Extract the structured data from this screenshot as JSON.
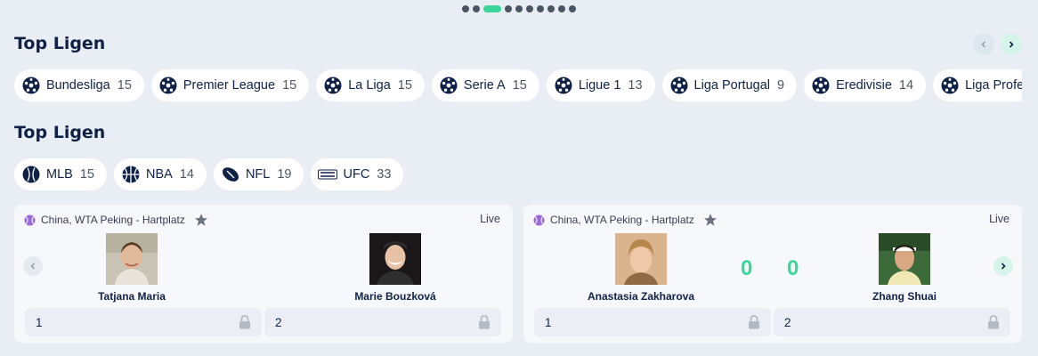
{
  "pager": {
    "count": 10,
    "active_index": 2
  },
  "top_leagues": {
    "title": "Top Ligen",
    "items": [
      {
        "label": "Bundesliga",
        "count": "15",
        "icon": "soccer-ball-icon"
      },
      {
        "label": "Premier League",
        "count": "15",
        "icon": "soccer-ball-icon"
      },
      {
        "label": "La Liga",
        "count": "15",
        "icon": "soccer-ball-icon"
      },
      {
        "label": "Serie A",
        "count": "15",
        "icon": "soccer-ball-icon"
      },
      {
        "label": "Ligue 1",
        "count": "13",
        "icon": "soccer-ball-icon"
      },
      {
        "label": "Liga Portugal",
        "count": "9",
        "icon": "soccer-ball-icon"
      },
      {
        "label": "Eredivisie",
        "count": "14",
        "icon": "soccer-ball-icon"
      },
      {
        "label": "Liga Profesional",
        "count": "",
        "icon": "soccer-ball-icon"
      }
    ]
  },
  "top_leagues_2": {
    "title": "Top Ligen",
    "items": [
      {
        "label": "MLB",
        "count": "15",
        "icon": "baseball-icon"
      },
      {
        "label": "NBA",
        "count": "14",
        "icon": "basketball-icon"
      },
      {
        "label": "NFL",
        "count": "19",
        "icon": "american-football-icon"
      },
      {
        "label": "UFC",
        "count": "33",
        "icon": "mma-icon"
      }
    ]
  },
  "matches": [
    {
      "league": "China, WTA Peking - Hartplatz",
      "status": "Live",
      "home": {
        "name": "Tatjana Maria"
      },
      "away": {
        "name": "Marie Bouzková"
      },
      "home_score": "",
      "away_score": "",
      "odds": [
        {
          "label": "1"
        },
        {
          "label": "2"
        }
      ]
    },
    {
      "league": "China, WTA Peking - Hartplatz",
      "status": "Live",
      "home": {
        "name": "Anastasia Zakharova"
      },
      "away": {
        "name": "Zhang Shuai"
      },
      "home_score": "0",
      "away_score": "0",
      "odds": [
        {
          "label": "1"
        },
        {
          "label": "2"
        }
      ]
    }
  ],
  "colors": {
    "accent": "#3dd69a",
    "navy": "#0f2147",
    "background": "#e9edf4",
    "tennis": "#9b6ad9"
  }
}
